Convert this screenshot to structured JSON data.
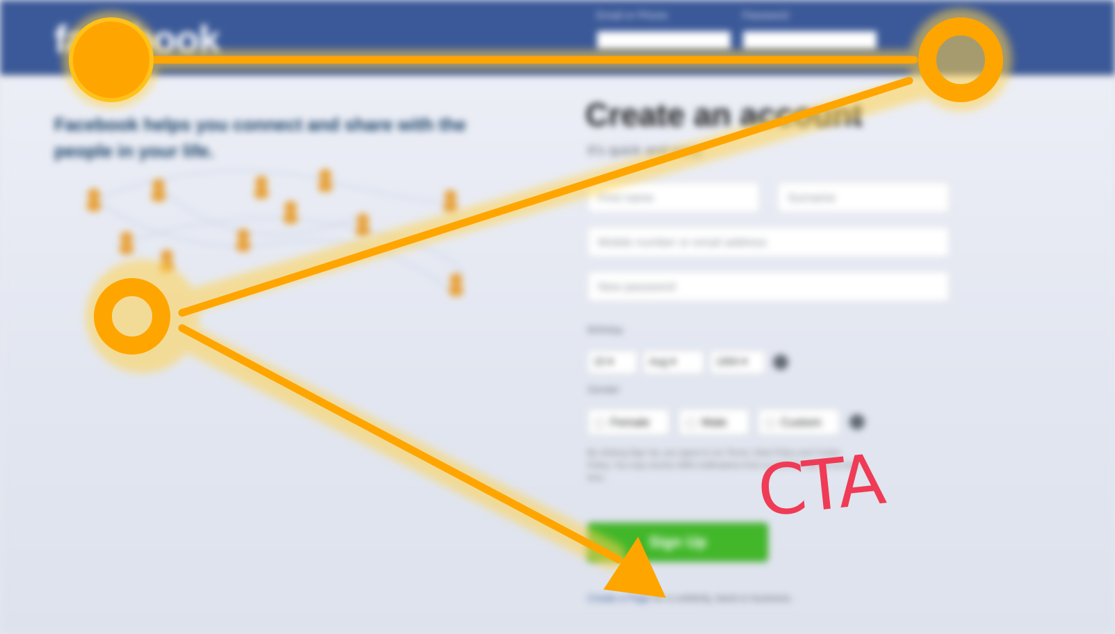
{
  "header": {
    "logo": "facebook",
    "email_label": "Email or Phone",
    "password_label": "Password",
    "brand_color": "#3b5998"
  },
  "intro": {
    "tagline": "Facebook helps you connect and share with the people in your life."
  },
  "signup": {
    "title": "Create an account",
    "subtitle": "It's quick and easy.",
    "first_name_placeholder": "First name",
    "surname_placeholder": "Surname",
    "mobile_placeholder": "Mobile number or email address",
    "password_placeholder": "New password",
    "birthday_label": "Birthday",
    "day": "15",
    "month": "Aug",
    "year": "1994",
    "gender_label": "Gender",
    "gender_options": [
      "Female",
      "Male",
      "Custom"
    ],
    "terms": "By clicking Sign Up, you agree to our Terms, Data Policy and Cookie Policy. You may receive SMS notifications from us and can opt out at any time.",
    "button_label": "Sign Up",
    "button_color": "#42b72a",
    "page_link": "Create a Page",
    "page_link_suffix": " for a celebrity, band or business."
  },
  "annotation": {
    "cta_text": "CTA",
    "path_color": "#ffa500",
    "cta_color": "#ef3b55"
  }
}
